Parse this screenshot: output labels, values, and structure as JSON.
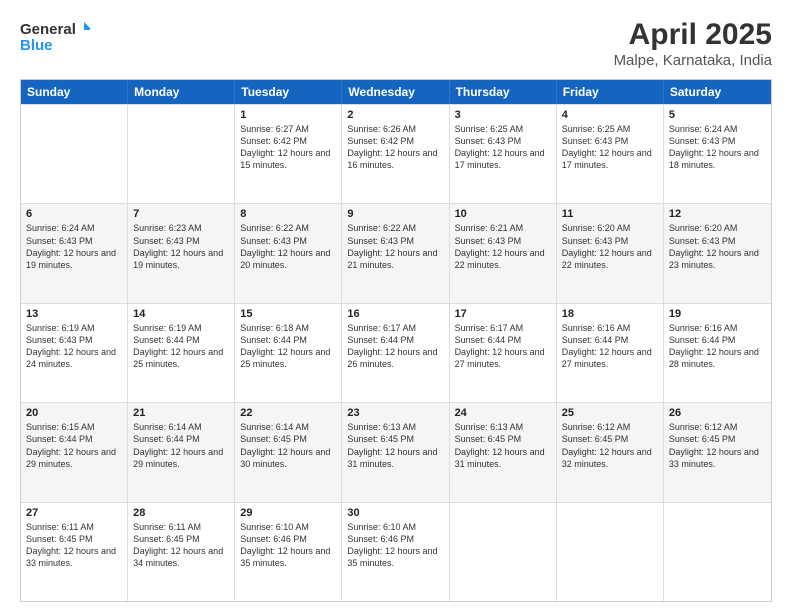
{
  "header": {
    "logo_general": "General",
    "logo_blue": "Blue",
    "month_title": "April 2025",
    "location": "Malpe, Karnataka, India"
  },
  "weekdays": [
    "Sunday",
    "Monday",
    "Tuesday",
    "Wednesday",
    "Thursday",
    "Friday",
    "Saturday"
  ],
  "weeks": [
    [
      {
        "day": "",
        "sunrise": "",
        "sunset": "",
        "daylight": ""
      },
      {
        "day": "",
        "sunrise": "",
        "sunset": "",
        "daylight": ""
      },
      {
        "day": "1",
        "sunrise": "Sunrise: 6:27 AM",
        "sunset": "Sunset: 6:42 PM",
        "daylight": "Daylight: 12 hours and 15 minutes."
      },
      {
        "day": "2",
        "sunrise": "Sunrise: 6:26 AM",
        "sunset": "Sunset: 6:42 PM",
        "daylight": "Daylight: 12 hours and 16 minutes."
      },
      {
        "day": "3",
        "sunrise": "Sunrise: 6:25 AM",
        "sunset": "Sunset: 6:43 PM",
        "daylight": "Daylight: 12 hours and 17 minutes."
      },
      {
        "day": "4",
        "sunrise": "Sunrise: 6:25 AM",
        "sunset": "Sunset: 6:43 PM",
        "daylight": "Daylight: 12 hours and 17 minutes."
      },
      {
        "day": "5",
        "sunrise": "Sunrise: 6:24 AM",
        "sunset": "Sunset: 6:43 PM",
        "daylight": "Daylight: 12 hours and 18 minutes."
      }
    ],
    [
      {
        "day": "6",
        "sunrise": "Sunrise: 6:24 AM",
        "sunset": "Sunset: 6:43 PM",
        "daylight": "Daylight: 12 hours and 19 minutes."
      },
      {
        "day": "7",
        "sunrise": "Sunrise: 6:23 AM",
        "sunset": "Sunset: 6:43 PM",
        "daylight": "Daylight: 12 hours and 19 minutes."
      },
      {
        "day": "8",
        "sunrise": "Sunrise: 6:22 AM",
        "sunset": "Sunset: 6:43 PM",
        "daylight": "Daylight: 12 hours and 20 minutes."
      },
      {
        "day": "9",
        "sunrise": "Sunrise: 6:22 AM",
        "sunset": "Sunset: 6:43 PM",
        "daylight": "Daylight: 12 hours and 21 minutes."
      },
      {
        "day": "10",
        "sunrise": "Sunrise: 6:21 AM",
        "sunset": "Sunset: 6:43 PM",
        "daylight": "Daylight: 12 hours and 22 minutes."
      },
      {
        "day": "11",
        "sunrise": "Sunrise: 6:20 AM",
        "sunset": "Sunset: 6:43 PM",
        "daylight": "Daylight: 12 hours and 22 minutes."
      },
      {
        "day": "12",
        "sunrise": "Sunrise: 6:20 AM",
        "sunset": "Sunset: 6:43 PM",
        "daylight": "Daylight: 12 hours and 23 minutes."
      }
    ],
    [
      {
        "day": "13",
        "sunrise": "Sunrise: 6:19 AM",
        "sunset": "Sunset: 6:43 PM",
        "daylight": "Daylight: 12 hours and 24 minutes."
      },
      {
        "day": "14",
        "sunrise": "Sunrise: 6:19 AM",
        "sunset": "Sunset: 6:44 PM",
        "daylight": "Daylight: 12 hours and 25 minutes."
      },
      {
        "day": "15",
        "sunrise": "Sunrise: 6:18 AM",
        "sunset": "Sunset: 6:44 PM",
        "daylight": "Daylight: 12 hours and 25 minutes."
      },
      {
        "day": "16",
        "sunrise": "Sunrise: 6:17 AM",
        "sunset": "Sunset: 6:44 PM",
        "daylight": "Daylight: 12 hours and 26 minutes."
      },
      {
        "day": "17",
        "sunrise": "Sunrise: 6:17 AM",
        "sunset": "Sunset: 6:44 PM",
        "daylight": "Daylight: 12 hours and 27 minutes."
      },
      {
        "day": "18",
        "sunrise": "Sunrise: 6:16 AM",
        "sunset": "Sunset: 6:44 PM",
        "daylight": "Daylight: 12 hours and 27 minutes."
      },
      {
        "day": "19",
        "sunrise": "Sunrise: 6:16 AM",
        "sunset": "Sunset: 6:44 PM",
        "daylight": "Daylight: 12 hours and 28 minutes."
      }
    ],
    [
      {
        "day": "20",
        "sunrise": "Sunrise: 6:15 AM",
        "sunset": "Sunset: 6:44 PM",
        "daylight": "Daylight: 12 hours and 29 minutes."
      },
      {
        "day": "21",
        "sunrise": "Sunrise: 6:14 AM",
        "sunset": "Sunset: 6:44 PM",
        "daylight": "Daylight: 12 hours and 29 minutes."
      },
      {
        "day": "22",
        "sunrise": "Sunrise: 6:14 AM",
        "sunset": "Sunset: 6:45 PM",
        "daylight": "Daylight: 12 hours and 30 minutes."
      },
      {
        "day": "23",
        "sunrise": "Sunrise: 6:13 AM",
        "sunset": "Sunset: 6:45 PM",
        "daylight": "Daylight: 12 hours and 31 minutes."
      },
      {
        "day": "24",
        "sunrise": "Sunrise: 6:13 AM",
        "sunset": "Sunset: 6:45 PM",
        "daylight": "Daylight: 12 hours and 31 minutes."
      },
      {
        "day": "25",
        "sunrise": "Sunrise: 6:12 AM",
        "sunset": "Sunset: 6:45 PM",
        "daylight": "Daylight: 12 hours and 32 minutes."
      },
      {
        "day": "26",
        "sunrise": "Sunrise: 6:12 AM",
        "sunset": "Sunset: 6:45 PM",
        "daylight": "Daylight: 12 hours and 33 minutes."
      }
    ],
    [
      {
        "day": "27",
        "sunrise": "Sunrise: 6:11 AM",
        "sunset": "Sunset: 6:45 PM",
        "daylight": "Daylight: 12 hours and 33 minutes."
      },
      {
        "day": "28",
        "sunrise": "Sunrise: 6:11 AM",
        "sunset": "Sunset: 6:45 PM",
        "daylight": "Daylight: 12 hours and 34 minutes."
      },
      {
        "day": "29",
        "sunrise": "Sunrise: 6:10 AM",
        "sunset": "Sunset: 6:46 PM",
        "daylight": "Daylight: 12 hours and 35 minutes."
      },
      {
        "day": "30",
        "sunrise": "Sunrise: 6:10 AM",
        "sunset": "Sunset: 6:46 PM",
        "daylight": "Daylight: 12 hours and 35 minutes."
      },
      {
        "day": "",
        "sunrise": "",
        "sunset": "",
        "daylight": ""
      },
      {
        "day": "",
        "sunrise": "",
        "sunset": "",
        "daylight": ""
      },
      {
        "day": "",
        "sunrise": "",
        "sunset": "",
        "daylight": ""
      }
    ]
  ]
}
